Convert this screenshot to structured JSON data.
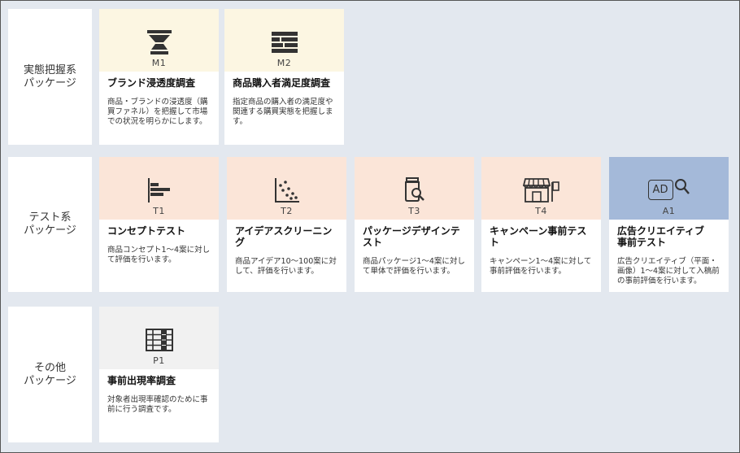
{
  "rows": [
    {
      "label_line1": "実態把握系",
      "label_line2": "パッケージ"
    },
    {
      "label_line1": "テスト系",
      "label_line2": "パッケージ"
    },
    {
      "label_line1": "その他",
      "label_line2": "パッケージ"
    }
  ],
  "cards": {
    "m1": {
      "code": "M1",
      "icon": "funnel-icon",
      "title": "ブランド浸透度調査",
      "desc": "商品・ブランドの浸透度（購買ファネル）を把握して市場での状況を明らかにします。"
    },
    "m2": {
      "code": "M2",
      "icon": "list-bars-icon",
      "title": "商品購入者満足度調査",
      "desc": "指定商品の購入者の満足度や関連する購買実態を把握します。"
    },
    "t1": {
      "code": "T1",
      "icon": "bar-chart-icon",
      "title": "コンセプトテスト",
      "desc": "商品コンセプト1～4案に対して評価を行います。"
    },
    "t2": {
      "code": "T2",
      "icon": "scatter-plot-icon",
      "title": "アイデアスクリーニング",
      "desc": "商品アイデア10～100案に対して、評価を行います。"
    },
    "t3": {
      "code": "T3",
      "icon": "package-search-icon",
      "title": "パッケージデザインテスト",
      "desc": "商品パッケージ1～4案に対して単体で評価を行います。"
    },
    "t4": {
      "code": "T4",
      "icon": "storefront-icon",
      "title": "キャンペーン事前テスト",
      "desc": "キャンペーン1～4案に対して事前評価を行います。"
    },
    "a1": {
      "code": "A1",
      "icon": "ad-search-icon",
      "ad_text": "AD",
      "title_line1": "広告クリエイティブ",
      "title_line2": "事前テスト",
      "desc": "広告クリエイティブ（平面・画像）1～4案に対して入稿前の事前評価を行います。"
    },
    "p1": {
      "code": "P1",
      "icon": "grid-table-icon",
      "title": "事前出現率調査",
      "desc": "対象者出現率確認のために事前に行う調査です。"
    }
  },
  "colors": {
    "background": "#e3e8ef",
    "yellow_head": "#fcf6e2",
    "peach_head": "#fbe5d8",
    "blue_head": "#a4b9d9",
    "gray_head": "#f1f1f1"
  }
}
